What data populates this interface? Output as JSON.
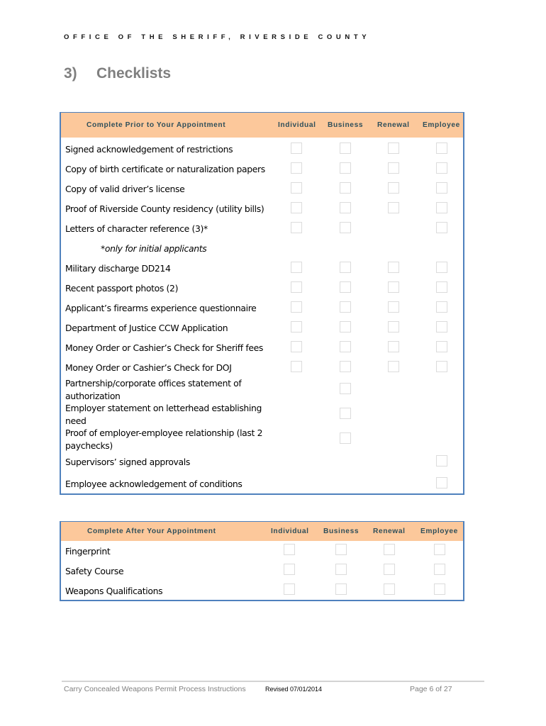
{
  "header": {
    "office": "OFFICE OF THE SHERIFF, RIVERSIDE COUNTY"
  },
  "section": {
    "number": "3)",
    "title": "Checklists"
  },
  "columns": [
    "Individual",
    "Business",
    "Renewal",
    "Employee"
  ],
  "prior_table": {
    "title": "Complete Prior to Your Appointment",
    "rows": [
      {
        "label": "Signed acknowledgement of restrictions",
        "boxes": [
          true,
          true,
          true,
          true
        ]
      },
      {
        "label": "Copy of birth certificate or naturalization papers",
        "boxes": [
          true,
          true,
          true,
          true
        ]
      },
      {
        "label": "Copy of valid driver’s license",
        "boxes": [
          true,
          true,
          true,
          true
        ]
      },
      {
        "label": "Proof of Riverside County residency (utility bills)",
        "boxes": [
          true,
          true,
          true,
          true
        ]
      },
      {
        "label": "Letters of character reference (3)*",
        "boxes": [
          true,
          true,
          false,
          true
        ]
      },
      {
        "label": "*only for initial applicants",
        "note": true,
        "boxes": [
          false,
          false,
          false,
          false
        ]
      },
      {
        "label": "Military discharge DD214",
        "boxes": [
          true,
          true,
          true,
          true
        ]
      },
      {
        "label": "Recent passport photos (2)",
        "boxes": [
          true,
          true,
          true,
          true
        ]
      },
      {
        "label": "Applicant’s firearms experience questionnaire",
        "boxes": [
          true,
          true,
          true,
          true
        ]
      },
      {
        "label": "Department of Justice CCW Application",
        "boxes": [
          true,
          true,
          true,
          true
        ]
      },
      {
        "label": "Money Order or Cashier’s Check for Sheriff fees",
        "boxes": [
          true,
          true,
          true,
          true
        ]
      },
      {
        "label": "Money Order or Cashier’s Check for DOJ",
        "boxes": [
          true,
          true,
          true,
          true
        ]
      },
      {
        "label": "Partnership/corporate offices statement of authorization",
        "line1": "Partnership/corporate offices statement of",
        "line2": "authorization",
        "boxes": [
          false,
          true,
          false,
          false
        ]
      },
      {
        "label": "Employer statement on letterhead establishing need",
        "line1": "Employer statement on letterhead establishing",
        "line2": "need",
        "boxes": [
          false,
          true,
          false,
          false
        ]
      },
      {
        "label": "Proof of employer-employee relationship (last 2 paychecks)",
        "line1": "Proof of employer-employee relationship (last 2",
        "line2": "paychecks)",
        "boxes": [
          false,
          true,
          false,
          false
        ]
      },
      {
        "label": "Supervisors’ signed approvals",
        "boxes": [
          false,
          false,
          false,
          true
        ]
      },
      {
        "label": "Employee acknowledgement of conditions",
        "boxes": [
          false,
          false,
          false,
          true
        ]
      }
    ]
  },
  "after_table": {
    "title": "Complete After Your Appointment",
    "rows": [
      {
        "label": "Fingerprint",
        "boxes": [
          true,
          true,
          true,
          true
        ]
      },
      {
        "label": "Safety Course",
        "boxes": [
          true,
          true,
          true,
          true
        ]
      },
      {
        "label": "Weapons Qualifications",
        "boxes": [
          true,
          true,
          true,
          true
        ]
      }
    ]
  },
  "footer": {
    "doc_title": "Carry Concealed Weapons Permit Process Instructions",
    "revised": "Revised 07/01/2014",
    "page": "Page 6 of 27"
  },
  "colors": {
    "header_fill": "#fcc89b",
    "header_text": "#2f4f5a",
    "table_border": "#4f81bd",
    "title_gray": "#7f7f7f"
  }
}
